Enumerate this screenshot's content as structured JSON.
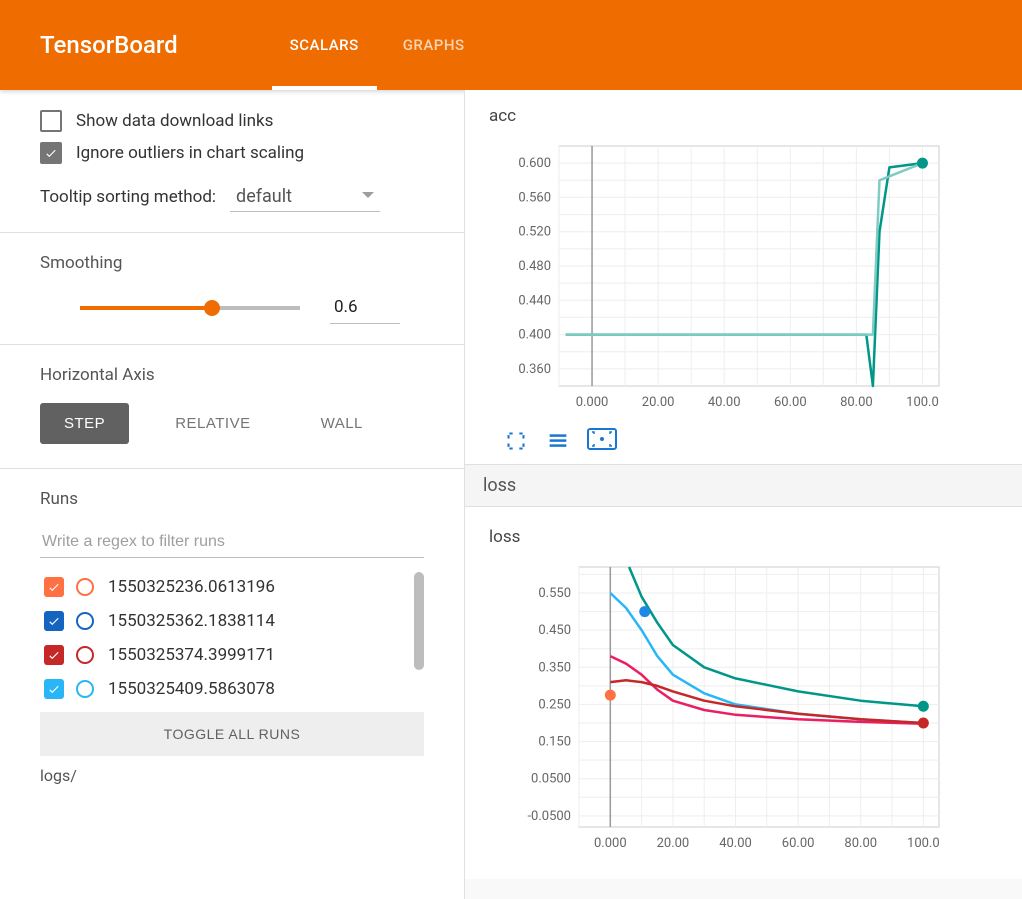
{
  "header": {
    "brand": "TensorBoard",
    "tabs": [
      "SCALARS",
      "GRAPHS"
    ],
    "active_tab": 0
  },
  "options": {
    "show_download_links": {
      "label": "Show data download links",
      "checked": false
    },
    "ignore_outliers": {
      "label": "Ignore outliers in chart scaling",
      "checked": true
    },
    "tooltip_sorting_label": "Tooltip sorting method:",
    "tooltip_sorting_value": "default"
  },
  "smoothing": {
    "label": "Smoothing",
    "value": "0.6"
  },
  "horizontal_axis": {
    "label": "Horizontal Axis",
    "options": [
      "STEP",
      "RELATIVE",
      "WALL"
    ],
    "active": "STEP"
  },
  "runs": {
    "label": "Runs",
    "filter_placeholder": "Write a regex to filter runs",
    "items": [
      {
        "name": "1550325236.0613196",
        "color": "#ff7043",
        "checked": true
      },
      {
        "name": "1550325362.1838114",
        "color": "#1565c0",
        "checked": true
      },
      {
        "name": "1550325374.3999171",
        "color": "#c62828",
        "checked": true
      },
      {
        "name": "1550325409.5863078",
        "color": "#29b6f6",
        "checked": true
      }
    ],
    "toggle_all_label": "TOGGLE ALL RUNS",
    "log_path": "logs/"
  },
  "sections": {
    "loss_header": "loss"
  },
  "colors": {
    "accent": "#ef6c00",
    "teal": "#009688",
    "lightblue": "#29b6f6",
    "blue": "#1e88e5",
    "red": "#c62828",
    "magenta": "#e91e63",
    "orange": "#ff7043"
  },
  "chart_data": [
    {
      "name": "acc",
      "type": "line",
      "title": "acc",
      "xlabel": "",
      "ylabel": "",
      "x_ticks": [
        "0.000",
        "20.00",
        "40.00",
        "60.00",
        "80.00",
        "100.0"
      ],
      "y_ticks": [
        "0.360",
        "0.400",
        "0.440",
        "0.480",
        "0.520",
        "0.560",
        "0.600"
      ],
      "xlim": [
        -10,
        105
      ],
      "ylim": [
        0.34,
        0.62
      ],
      "series": [
        {
          "name": "acc-teal",
          "color": "#009688",
          "x": [
            -8,
            0,
            80,
            83,
            85,
            87,
            90,
            100
          ],
          "y": [
            0.4,
            0.4,
            0.4,
            0.4,
            0.34,
            0.52,
            0.595,
            0.6
          ]
        },
        {
          "name": "acc-lightteal",
          "color": "#80cbc4",
          "x": [
            -8,
            0,
            80,
            85,
            87,
            100
          ],
          "y": [
            0.4,
            0.4,
            0.4,
            0.4,
            0.58,
            0.6
          ]
        }
      ],
      "endpoint": {
        "x": 100,
        "y": 0.6,
        "color": "#009688"
      }
    },
    {
      "name": "loss",
      "type": "line",
      "title": "loss",
      "xlabel": "",
      "ylabel": "",
      "x_ticks": [
        "0.000",
        "20.00",
        "40.00",
        "60.00",
        "80.00",
        "100.0"
      ],
      "y_ticks": [
        "-0.0500",
        "0.0500",
        "0.150",
        "0.250",
        "0.350",
        "0.450",
        "0.550"
      ],
      "xlim": [
        -10,
        105
      ],
      "ylim": [
        -0.08,
        0.62
      ],
      "series": [
        {
          "name": "teal",
          "color": "#009688",
          "x": [
            6,
            10,
            15,
            20,
            30,
            40,
            60,
            80,
            100
          ],
          "y": [
            0.62,
            0.54,
            0.47,
            0.41,
            0.35,
            0.32,
            0.285,
            0.26,
            0.245
          ]
        },
        {
          "name": "lightblue",
          "color": "#29b6f6",
          "x": [
            0,
            5,
            10,
            15,
            20,
            30,
            40,
            60,
            80,
            100
          ],
          "y": [
            0.55,
            0.51,
            0.45,
            0.38,
            0.33,
            0.28,
            0.25,
            0.225,
            0.21,
            0.2
          ]
        },
        {
          "name": "magenta",
          "color": "#e91e63",
          "x": [
            0,
            5,
            10,
            15,
            20,
            30,
            40,
            60,
            80,
            100
          ],
          "y": [
            0.38,
            0.36,
            0.33,
            0.29,
            0.26,
            0.235,
            0.222,
            0.21,
            0.203,
            0.198
          ]
        },
        {
          "name": "red",
          "color": "#c62828",
          "x": [
            0,
            5,
            10,
            15,
            20,
            30,
            40,
            60,
            80,
            100
          ],
          "y": [
            0.31,
            0.315,
            0.31,
            0.3,
            0.285,
            0.26,
            0.245,
            0.225,
            0.21,
            0.2
          ]
        }
      ],
      "endpoints": [
        {
          "x": 11,
          "y": 0.5,
          "color": "#1e88e5"
        },
        {
          "x": 0,
          "y": 0.275,
          "color": "#ff7043"
        },
        {
          "x": 100,
          "y": 0.245,
          "color": "#009688"
        },
        {
          "x": 100,
          "y": 0.2,
          "color": "#c62828"
        }
      ]
    }
  ]
}
